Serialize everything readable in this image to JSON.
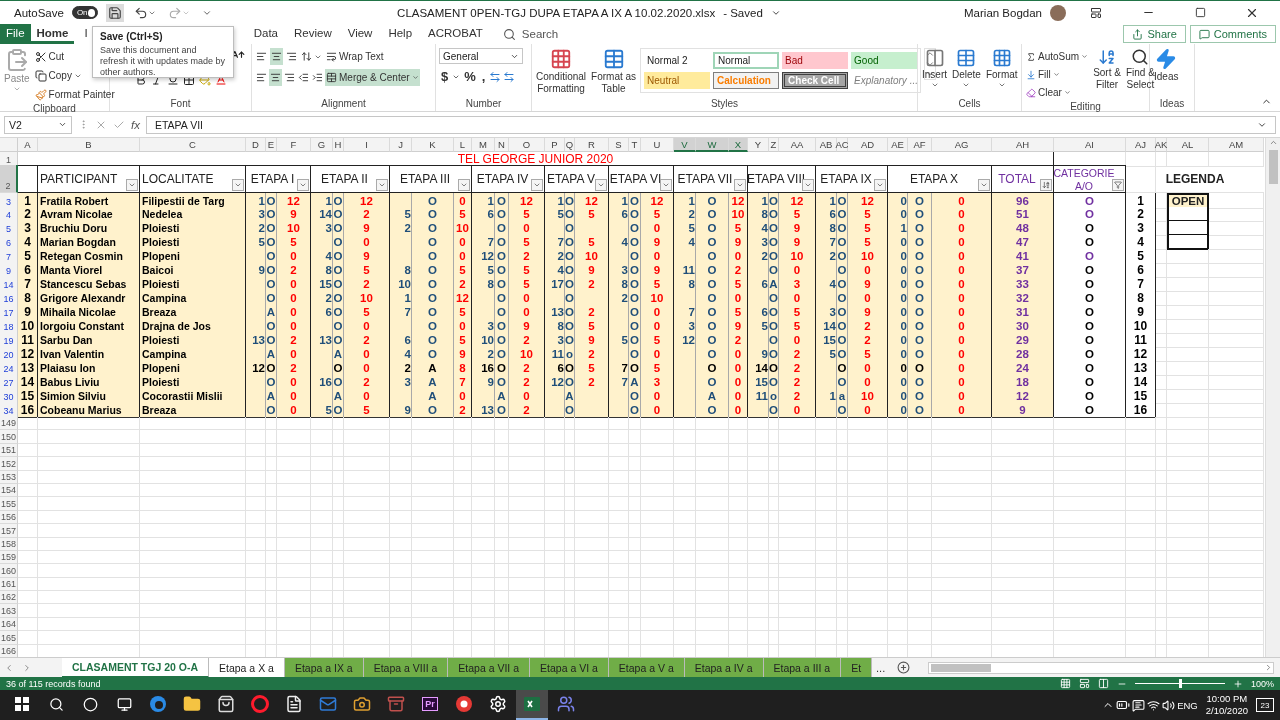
{
  "title_bar": {
    "autosave_label": "AutoSave",
    "autosave_state": "On",
    "autosave_on": true,
    "file_title": "CLASAMENT 0PEN-TGJ DUPA ETAPA A IX A 10.02.2020.xlsx",
    "save_status": "- Saved",
    "user": "Marian Bogdan"
  },
  "ribbon_tabs": [
    {
      "label": "File",
      "kind": "file",
      "selected": false
    },
    {
      "label": "Home",
      "kind": "tab",
      "selected": true
    },
    {
      "label": "I",
      "kind": "tab",
      "selected": false
    },
    {
      "label": "Data",
      "kind": "tab",
      "selected": false
    },
    {
      "label": "Review",
      "kind": "tab",
      "selected": false
    },
    {
      "label": "View",
      "kind": "tab",
      "selected": false
    },
    {
      "label": "Help",
      "kind": "tab",
      "selected": false
    },
    {
      "label": "ACROBAT",
      "kind": "tab",
      "selected": false
    }
  ],
  "search": {
    "placeholder": "Search"
  },
  "share_button": "Share",
  "comments_button": "Comments",
  "tooltip": {
    "title": "Save (Ctrl+S)",
    "text": "Save this document and refresh it with updates made by other authors."
  },
  "ribbon": {
    "clipboard": {
      "label": "Clipboard",
      "paste": "Paste",
      "cut": "Cut",
      "copy": "Copy",
      "format_painter": "Format Painter"
    },
    "font": {
      "label": "Font"
    },
    "alignment": {
      "label": "Alignment",
      "wrap_text": "Wrap Text",
      "merge_center": "Merge & Center",
      "merge_active": true
    },
    "number": {
      "label": "Number",
      "format": "General",
      "currency": "$",
      "percent": "%",
      "comma": ","
    },
    "styles": {
      "label": "Styles",
      "conditional": [
        "Conditional",
        "Formatting"
      ],
      "format_table": [
        "Format as",
        "Table"
      ],
      "cells": [
        {
          "text": "Normal 2",
          "kind": "normal2"
        },
        {
          "text": "Normal",
          "kind": "normal"
        },
        {
          "text": "Bad",
          "kind": "bad"
        },
        {
          "text": "Good",
          "kind": "good"
        },
        {
          "text": "Neutral",
          "kind": "neutral"
        },
        {
          "text": "Calculation",
          "kind": "calculation"
        },
        {
          "text": "Check Cell",
          "kind": "check"
        },
        {
          "text": "Explanatory ...",
          "kind": "explanatory"
        }
      ]
    },
    "cells": {
      "label": "Cells",
      "buttons": [
        {
          "text": "Insert",
          "kind": "insert"
        },
        {
          "text": "Delete",
          "kind": "delete"
        },
        {
          "text": "Format",
          "kind": "format"
        }
      ]
    },
    "editing": {
      "label": "Editing",
      "autosum": "AutoSum",
      "fill": "Fill",
      "clear": "Clear",
      "sort": [
        "Sort &",
        "Filter"
      ],
      "find": [
        "Find &",
        "Select"
      ]
    },
    "ideas": {
      "label": "Ideas",
      "button": "Ideas"
    }
  },
  "formula_bar": {
    "name_box": "V2",
    "function_label": "fx",
    "content": "ETAPA VII"
  },
  "columns": [
    {
      "letter": "A",
      "selected": false
    },
    {
      "letter": "B",
      "selected": false
    },
    {
      "letter": "C",
      "selected": false
    },
    {
      "letter": "D",
      "selected": false
    },
    {
      "letter": "E",
      "selected": false
    },
    {
      "letter": "F",
      "selected": false
    },
    {
      "letter": "G",
      "selected": false
    },
    {
      "letter": "H",
      "selected": false
    },
    {
      "letter": "I",
      "selected": false
    },
    {
      "letter": "J",
      "selected": false
    },
    {
      "letter": "K",
      "selected": false
    },
    {
      "letter": "L",
      "selected": false
    },
    {
      "letter": "M",
      "selected": false
    },
    {
      "letter": "N",
      "selected": false
    },
    {
      "letter": "O",
      "selected": false
    },
    {
      "letter": "P",
      "selected": false
    },
    {
      "letter": "Q",
      "selected": false
    },
    {
      "letter": "R",
      "selected": false
    },
    {
      "letter": "S",
      "selected": false
    },
    {
      "letter": "T",
      "selected": false
    },
    {
      "letter": "U",
      "selected": false
    },
    {
      "letter": "V",
      "selected": true
    },
    {
      "letter": "W",
      "selected": true
    },
    {
      "letter": "X",
      "selected": true
    },
    {
      "letter": "Y",
      "selected": false
    },
    {
      "letter": "Z",
      "selected": false
    },
    {
      "letter": "AA",
      "selected": false
    },
    {
      "letter": "AB",
      "selected": false
    },
    {
      "letter": "AC",
      "selected": false
    },
    {
      "letter": "AD",
      "selected": false
    },
    {
      "letter": "AE",
      "selected": false
    },
    {
      "letter": "AF",
      "selected": false
    },
    {
      "letter": "AG",
      "selected": false
    },
    {
      "letter": "AH",
      "selected": false
    },
    {
      "letter": "AI",
      "selected": false
    },
    {
      "letter": "AJ",
      "selected": false
    },
    {
      "letter": "AK",
      "selected": false
    },
    {
      "letter": "AL",
      "selected": false
    },
    {
      "letter": "AM",
      "selected": false
    }
  ],
  "title_row": {
    "row_number": "1",
    "selected": false,
    "title": "TEL GEORGE JUNIOR 2020"
  },
  "header_row": {
    "row_number": "2",
    "selected": true,
    "participant": "PARTICIPANT",
    "locality": "LOCALITATE",
    "stages": [
      "ETAPA I",
      "ETAPA II",
      "ETAPA III",
      "ETAPA IV",
      "ETAPA V",
      "ETAPA VI",
      "ETAPA VII",
      "ETAPA VIII",
      "ETAPA IX",
      "ETAPA X"
    ],
    "total": "TOTAL",
    "category": [
      "CATEGORIE",
      "A/O"
    ],
    "legend": "LEGENDA"
  },
  "rows": [
    {
      "row_number": "3",
      "kind": "standard",
      "no": "1",
      "name": "Fratila Robert",
      "locality": "Filipestii de Targ",
      "stages": [
        {
          "place": "1",
          "cat": "O",
          "points": "12"
        },
        {
          "place": "1",
          "cat": "O",
          "points": "12"
        },
        {
          "cat": "O",
          "points": "0"
        },
        {
          "place": "1",
          "cat": "O",
          "points": "12"
        },
        {
          "place": "1",
          "cat": "O",
          "points": "12"
        },
        {
          "place": "1",
          "cat": "O",
          "points": "12"
        },
        {
          "place": "1",
          "cat": "O",
          "points": "12"
        },
        {
          "place": "1",
          "cat": "O",
          "points": "12"
        },
        {
          "place": "1",
          "cat": "O",
          "points": "12"
        },
        {
          "place": "0",
          "cat": "O",
          "points": "0"
        }
      ],
      "total": "96",
      "category": {
        "text": "O",
        "color": "#7030a0"
      },
      "place": "1"
    },
    {
      "row_number": "4",
      "kind": "standard",
      "no": "2",
      "name": "Avram Nicolae",
      "locality": "Nedelea",
      "stages": [
        {
          "place": "3",
          "cat": "O",
          "points": "9"
        },
        {
          "place": "14",
          "cat": "O",
          "points": "2"
        },
        {
          "place": "5",
          "cat": "O",
          "points": "5"
        },
        {
          "place": "6",
          "cat": "O",
          "points": "5"
        },
        {
          "place": "5",
          "cat": "O",
          "points": "5"
        },
        {
          "place": "6",
          "cat": "O",
          "points": "5"
        },
        {
          "place": "2",
          "cat": "O",
          "points": "10"
        },
        {
          "place": "8",
          "cat": "O",
          "points": "5"
        },
        {
          "place": "6",
          "cat": "O",
          "points": "5"
        },
        {
          "place": "0",
          "cat": "O",
          "points": "0"
        }
      ],
      "total": "51",
      "category": {
        "text": "O",
        "color": "#7030a0"
      },
      "place": "2"
    },
    {
      "row_number": "5",
      "kind": "standard",
      "no": "3",
      "name": "Bruchiu Doru",
      "locality": "Ploiesti",
      "stages": [
        {
          "place": "2",
          "cat": "O",
          "points": "10"
        },
        {
          "place": "3",
          "cat": "O",
          "points": "9"
        },
        {
          "place": "2",
          "cat": "O",
          "points": "10"
        },
        {
          "cat": "O",
          "points": "0"
        },
        {
          "cat": "O"
        },
        {
          "cat": "O",
          "points": "0"
        },
        {
          "place": "5",
          "cat": "O",
          "points": "5"
        },
        {
          "place": "4",
          "cat": "O",
          "points": "9"
        },
        {
          "place": "8",
          "cat": "O",
          "points": "5"
        },
        {
          "place": "1",
          "cat": "O",
          "points": "0"
        }
      ],
      "total": "48",
      "category": {
        "text": "O",
        "color": "#000000"
      },
      "place": "3"
    },
    {
      "row_number": "6",
      "kind": "standard",
      "no": "4",
      "name": "Marian Bogdan",
      "locality": "Ploiesti",
      "stages": [
        {
          "place": "5",
          "cat": "O",
          "points": "5"
        },
        {
          "cat": "O",
          "points": "0"
        },
        {
          "cat": "O",
          "points": "0"
        },
        {
          "place": "7",
          "cat": "O",
          "points": "5"
        },
        {
          "place": "7",
          "cat": "O",
          "points": "5"
        },
        {
          "place": "4",
          "cat": "O",
          "points": "9"
        },
        {
          "place": "4",
          "cat": "O",
          "points": "9"
        },
        {
          "place": "3",
          "cat": "O",
          "points": "9"
        },
        {
          "place": "7",
          "cat": "O",
          "points": "5"
        },
        {
          "place": "0",
          "cat": "O",
          "points": "0"
        }
      ],
      "total": "47",
      "category": {
        "text": "O",
        "color": "#000000"
      },
      "place": "4"
    },
    {
      "row_number": "7",
      "kind": "standard",
      "no": "5",
      "name": "Retegan Cosmin",
      "locality": "Plopeni",
      "stages": [
        {
          "cat": "O",
          "points": "0"
        },
        {
          "place": "4",
          "cat": "O",
          "points": "9"
        },
        {
          "cat": "O",
          "points": "0"
        },
        {
          "place": "12",
          "cat": "O",
          "points": "2"
        },
        {
          "place": "2",
          "cat": "O",
          "points": "10"
        },
        {
          "cat": "O",
          "points": "0"
        },
        {
          "cat": "O",
          "points": "0"
        },
        {
          "place": "2",
          "cat": "O",
          "points": "10"
        },
        {
          "place": "2",
          "cat": "O",
          "points": "10"
        },
        {
          "place": "0",
          "cat": "O",
          "points": "0"
        }
      ],
      "total": "41",
      "category": {
        "text": "O",
        "color": "#7030a0"
      },
      "place": "5"
    },
    {
      "row_number": "9",
      "kind": "standard",
      "no": "6",
      "name": "Manta Viorel",
      "locality": "Baicoi",
      "stages": [
        {
          "place": "9",
          "cat": "O",
          "points": "2"
        },
        {
          "place": "8",
          "cat": "O",
          "points": "5"
        },
        {
          "place": "8",
          "cat": "O",
          "points": "5"
        },
        {
          "place": "5",
          "cat": "O",
          "points": "5"
        },
        {
          "place": "4",
          "cat": "O",
          "points": "9"
        },
        {
          "place": "3",
          "cat": "O",
          "points": "9"
        },
        {
          "place": "11",
          "cat": "O",
          "points": "2"
        },
        {
          "cat": "O",
          "points": "0"
        },
        {
          "cat": "O",
          "points": "0"
        },
        {
          "place": "0",
          "cat": "O",
          "points": "0"
        }
      ],
      "total": "37",
      "category": {
        "text": "O",
        "color": "#000000"
      },
      "place": "6"
    },
    {
      "row_number": "14",
      "kind": "standard",
      "no": "7",
      "name": "Stancescu Sebas",
      "locality": "Ploiesti",
      "stages": [
        {
          "cat": "O",
          "points": "0"
        },
        {
          "place": "15",
          "cat": "O",
          "points": "2"
        },
        {
          "place": "10",
          "cat": "O",
          "points": "2"
        },
        {
          "place": "8",
          "cat": "O",
          "points": "5"
        },
        {
          "place": "17",
          "cat": "O",
          "points": "2"
        },
        {
          "place": "8",
          "cat": "O",
          "points": "5"
        },
        {
          "place": "8",
          "cat": "O",
          "points": "5"
        },
        {
          "place": "6",
          "cat": "A",
          "points": "3"
        },
        {
          "place": "4",
          "cat": "O",
          "points": "9"
        },
        {
          "place": "0",
          "cat": "O",
          "points": "0"
        }
      ],
      "total": "33",
      "category": {
        "text": "O",
        "color": "#000000"
      },
      "place": "7"
    },
    {
      "row_number": "16",
      "kind": "standard",
      "no": "8",
      "name": "Grigore Alexandr",
      "locality": "Campina",
      "stages": [
        {
          "cat": "O",
          "points": "0"
        },
        {
          "place": "2",
          "cat": "O",
          "points": "10"
        },
        {
          "place": "1",
          "cat": "O",
          "points": "12"
        },
        {
          "cat": "O",
          "points": "0"
        },
        {
          "cat": "O"
        },
        {
          "place": "2",
          "cat": "O",
          "points": "10"
        },
        {
          "cat": "O",
          "points": "0"
        },
        {
          "cat": "O",
          "points": "0"
        },
        {
          "cat": "O",
          "points": "0"
        },
        {
          "place": "0",
          "cat": "O",
          "points": "0"
        }
      ],
      "total": "32",
      "category": {
        "text": "O",
        "color": "#000000"
      },
      "place": "8"
    },
    {
      "row_number": "17",
      "kind": "standard",
      "no": "9",
      "name": "Mihaila Nicolae",
      "locality": "Breaza",
      "stages": [
        {
          "cat": "A",
          "points": "0"
        },
        {
          "place": "6",
          "cat": "O",
          "points": "5"
        },
        {
          "place": "7",
          "cat": "O",
          "points": "5"
        },
        {
          "cat": "O",
          "points": "0"
        },
        {
          "place": "13",
          "cat": "O",
          "points": "2"
        },
        {
          "cat": "O",
          "points": "0"
        },
        {
          "place": "7",
          "cat": "O",
          "points": "5"
        },
        {
          "place": "6",
          "cat": "O",
          "points": "5"
        },
        {
          "place": "3",
          "cat": "O",
          "points": "9"
        },
        {
          "place": "0",
          "cat": "O",
          "points": "0"
        }
      ],
      "total": "31",
      "category": {
        "text": "O",
        "color": "#000000"
      },
      "place": "9"
    },
    {
      "row_number": "18",
      "kind": "standard",
      "no": "10",
      "name": "Iorgoiu Constant",
      "locality": "Drajna de Jos",
      "stages": [
        {
          "cat": "O",
          "points": "0"
        },
        {
          "cat": "O",
          "points": "0"
        },
        {
          "cat": "O",
          "points": "0"
        },
        {
          "place": "3",
          "cat": "O",
          "points": "9"
        },
        {
          "place": "8",
          "cat": "O",
          "points": "5"
        },
        {
          "cat": "O",
          "points": "0"
        },
        {
          "place": "3",
          "cat": "O",
          "points": "9"
        },
        {
          "place": "5",
          "cat": "O",
          "points": "5"
        },
        {
          "place": "14",
          "cat": "O",
          "points": "2"
        },
        {
          "place": "0",
          "cat": "O",
          "points": "0"
        }
      ],
      "total": "30",
      "category": {
        "text": "O",
        "color": "#000000"
      },
      "place": "10"
    },
    {
      "row_number": "19",
      "kind": "standard",
      "no": "11",
      "name": "Sarbu Dan",
      "locality": "Ploiesti",
      "stages": [
        {
          "place": "13",
          "cat": "O",
          "points": "2"
        },
        {
          "place": "13",
          "cat": "O",
          "points": "2"
        },
        {
          "place": "6",
          "cat": "O",
          "points": "5"
        },
        {
          "place": "10",
          "cat": "O",
          "points": "2"
        },
        {
          "place": "3",
          "cat": "O",
          "points": "9"
        },
        {
          "place": "5",
          "cat": "O",
          "points": "5"
        },
        {
          "place": "12",
          "cat": "O",
          "points": "2"
        },
        {
          "cat": "O",
          "points": "0"
        },
        {
          "place": "15",
          "cat": "O",
          "points": "2"
        },
        {
          "place": "0",
          "cat": "O",
          "points": "0"
        }
      ],
      "total": "29",
      "category": {
        "text": "O",
        "color": "#000000"
      },
      "place": "11"
    },
    {
      "row_number": "20",
      "kind": "standard",
      "no": "12",
      "name": "Ivan Valentin",
      "locality": "Campina",
      "stages": [
        {
          "cat": "A",
          "points": "0"
        },
        {
          "cat": "A",
          "points": "0"
        },
        {
          "place": "4",
          "cat": "O",
          "points": "9"
        },
        {
          "place": "2",
          "cat": "O",
          "points": "10"
        },
        {
          "place": "11",
          "cat": "o",
          "points": "2"
        },
        {
          "cat": "O",
          "points": "0"
        },
        {
          "cat": "O",
          "points": "0"
        },
        {
          "place": "9",
          "cat": "O",
          "points": "2"
        },
        {
          "place": "5",
          "cat": "O",
          "points": "5"
        },
        {
          "place": "0",
          "cat": "O",
          "points": "0"
        }
      ],
      "total": "28",
      "category": {
        "text": "O",
        "color": "#000000"
      },
      "place": "12"
    },
    {
      "row_number": "24",
      "kind": "plain",
      "no": "13",
      "name": "Plaiasu Ion",
      "locality": "Plopeni",
      "stages": [
        {
          "place": "12",
          "cat": "O",
          "points": "2"
        },
        {
          "cat": "O",
          "points": "0"
        },
        {
          "place": "2",
          "cat": "A",
          "points": "8"
        },
        {
          "place": "16",
          "cat": "O",
          "points": "2"
        },
        {
          "place": "6",
          "cat": "O",
          "points": "5"
        },
        {
          "place": "7",
          "cat": "O",
          "points": "5"
        },
        {
          "cat": "O",
          "points": "0"
        },
        {
          "place": "14",
          "cat": "O",
          "points": "2"
        },
        {
          "cat": "O",
          "points": "0"
        },
        {
          "place": "0",
          "cat": "O",
          "points": "0"
        }
      ],
      "total": "24",
      "category": {
        "text": "O",
        "color": "#000000"
      },
      "place": "13"
    },
    {
      "row_number": "27",
      "kind": "standard",
      "no": "14",
      "name": "Babus Liviu",
      "locality": "Ploiesti",
      "stages": [
        {
          "cat": "O",
          "points": "0"
        },
        {
          "place": "16",
          "cat": "O",
          "points": "2"
        },
        {
          "place": "3",
          "cat": "A",
          "points": "7"
        },
        {
          "place": "9",
          "cat": "O",
          "points": "2"
        },
        {
          "place": "12",
          "cat": "O",
          "points": "2"
        },
        {
          "place": "7",
          "cat": "A",
          "points": "3"
        },
        {
          "cat": "O",
          "points": "0"
        },
        {
          "place": "15",
          "cat": "O",
          "points": "2"
        },
        {
          "cat": "O",
          "points": "0"
        },
        {
          "place": "0",
          "cat": "O",
          "points": "0"
        }
      ],
      "total": "18",
      "category": {
        "text": "O",
        "color": "#000000"
      },
      "place": "14"
    },
    {
      "row_number": "30",
      "kind": "standard",
      "no": "15",
      "name": "Simion Silviu",
      "locality": "Cocorastii Mislii",
      "stages": [
        {
          "cat": "A",
          "points": "0"
        },
        {
          "cat": "A",
          "points": "0"
        },
        {
          "cat": "A",
          "points": "0"
        },
        {
          "cat": "A",
          "points": "0"
        },
        {
          "cat": "A"
        },
        {
          "cat": "O",
          "points": "0"
        },
        {
          "cat": "A",
          "points": "0"
        },
        {
          "place": "11",
          "cat": "o",
          "points": "2"
        },
        {
          "place": "1",
          "cat": "a",
          "points": "10"
        },
        {
          "place": "0",
          "cat": "O",
          "points": "0"
        }
      ],
      "total": "12",
      "category": {
        "text": "O",
        "color": "#000000"
      },
      "place": "15"
    },
    {
      "row_number": "34",
      "kind": "standard",
      "no": "16",
      "name": "Cobeanu Marius",
      "locality": "Breaza",
      "stages": [
        {
          "cat": "O",
          "points": "0"
        },
        {
          "place": "5",
          "cat": "O",
          "points": "5"
        },
        {
          "place": "9",
          "cat": "O",
          "points": "2"
        },
        {
          "place": "13",
          "cat": "O",
          "points": "2"
        },
        {
          "cat": "O"
        },
        {
          "cat": "O",
          "points": "0"
        },
        {
          "cat": "O",
          "points": "0"
        },
        {
          "cat": "O",
          "points": "0"
        },
        {
          "cat": "O",
          "points": "0"
        },
        {
          "place": "0",
          "cat": "O",
          "points": "0"
        }
      ],
      "total": "9",
      "category": {
        "text": "O",
        "color": "#000000"
      },
      "place": "16"
    }
  ],
  "legend_items": [
    "OPEN"
  ],
  "empty_rows": [
    "149",
    "150",
    "151",
    "152",
    "153",
    "154",
    "155",
    "156",
    "157",
    "158",
    "159",
    "160",
    "161",
    "162",
    "163",
    "164",
    "165",
    "166"
  ],
  "sheet_tabs": [
    {
      "label": "CLASAMENT TGJ 20 O-A",
      "selected": true
    },
    {
      "label": "Etapa a X a",
      "selected": false
    },
    {
      "label": "Etapa a IX a",
      "selected": false,
      "color": "#70ad47"
    },
    {
      "label": "Etapa a VIII a",
      "selected": false,
      "color": "#70ad47"
    },
    {
      "label": "Etapa a VII a",
      "selected": false,
      "color": "#70ad47"
    },
    {
      "label": "Etapa a VI a",
      "selected": false,
      "color": "#70ad47"
    },
    {
      "label": "Etapa a V a",
      "selected": false,
      "color": "#70ad47"
    },
    {
      "label": "Etapa a IV a",
      "selected": false,
      "color": "#70ad47"
    },
    {
      "label": "Etapa a III a",
      "selected": false,
      "color": "#70ad47"
    },
    {
      "label": "Et",
      "selected": false,
      "color": "#70ad47"
    }
  ],
  "more_tabs": "...",
  "status_bar": {
    "text": "36 of 115 records found",
    "zoom": "100%",
    "zoom_slider": {
      "level": 0.5
    }
  },
  "taskbar": {
    "apps": [
      {
        "kind": "edge",
        "selected": false
      },
      {
        "kind": "explorer",
        "selected": false
      },
      {
        "kind": "store",
        "selected": false
      },
      {
        "kind": "opera",
        "selected": false
      },
      {
        "kind": "file",
        "selected": false
      },
      {
        "kind": "outlook",
        "selected": false
      },
      {
        "kind": "camera",
        "selected": false
      },
      {
        "kind": "archive",
        "selected": false
      },
      {
        "kind": "premiere",
        "label": "Pr",
        "selected": false
      },
      {
        "kind": "red",
        "selected": false
      },
      {
        "kind": "settings",
        "selected": false
      },
      {
        "kind": "excel",
        "selected": true
      },
      {
        "kind": "teams",
        "selected": false
      }
    ],
    "language": "ENG",
    "time": "10:00 PM",
    "date": "2/10/2020",
    "notifications": "23"
  }
}
